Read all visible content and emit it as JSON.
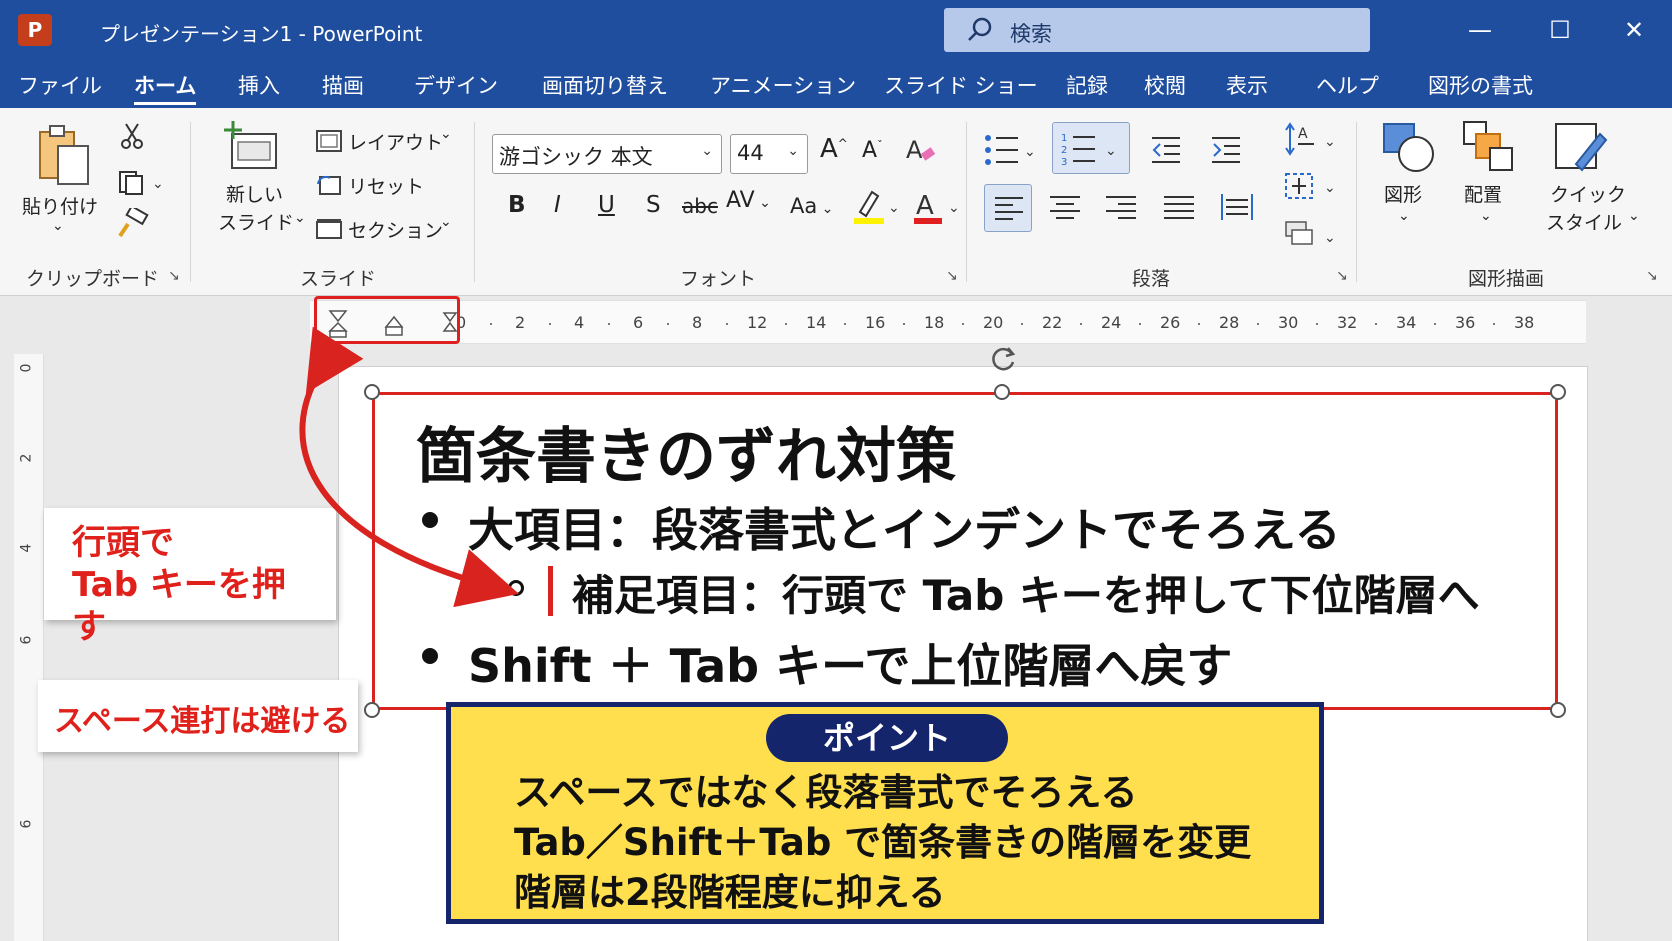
{
  "window": {
    "app_icon": "P",
    "title": "プレゼンテーション1  -  PowerPoint",
    "search_placeholder": "検索",
    "minimize": "—",
    "maximize": "☐",
    "close": "✕"
  },
  "menu_tabs": [
    "ファイル",
    "ホーム",
    "挿入",
    "描画",
    "デザイン",
    "画面切り替え",
    "アニメーション",
    "スライド ショー",
    "記録",
    "校閲",
    "表示",
    "ヘルプ",
    "図形の書式"
  ],
  "active_tab": "ホーム",
  "ribbon": {
    "clipboard": {
      "paste": "貼り付け",
      "label": "クリップボード"
    },
    "slides": {
      "new_slide_1": "新しい",
      "new_slide_2": "スライド",
      "layout": "レイアウト",
      "reset": "リセット",
      "section": "セクション",
      "label": "スライド"
    },
    "font": {
      "font_name": "游ゴシック 本文",
      "font_size": "44",
      "label": "フォント",
      "bold": "B",
      "italic": "I",
      "underline": "U",
      "shadow": "S",
      "strike": "abc",
      "spacing": "AV",
      "case": "Aa",
      "color": "A",
      "grow": "A",
      "shrink": "A"
    },
    "paragraph": {
      "label": "段落"
    },
    "drawing": {
      "shapes": "図形",
      "arrange": "配置",
      "quick_style_1": "クイック",
      "quick_style_2": "スタイル",
      "label": "図形描画"
    }
  },
  "ruler": {
    "numbers": [
      "0",
      "2",
      "4",
      "6",
      "8",
      "12",
      "14",
      "16",
      "18",
      "20",
      "22",
      "24",
      "26",
      "28",
      "30",
      "32",
      "34",
      "36",
      "38"
    ]
  },
  "vertical_ruler": {
    "numbers": [
      "0",
      "2",
      "4",
      "6",
      "6"
    ]
  },
  "slide": {
    "title": "箇条書きのずれ対策",
    "bullet_1": "大項目：段落書式とインデントでそろえる",
    "sub_bullet": "補足項目：行頭で Tab キーを押して下位階層へ",
    "bullet_2": "Shift ＋ Tab キーで上位階層へ戻す"
  },
  "callouts": {
    "tab_line1": "行頭で",
    "tab_line2": "Tab キーを押す",
    "space": "スペース連打は避ける"
  },
  "point": {
    "label": "ポイント",
    "lines": [
      "スペースではなく段落書式でそろえる",
      "Tab／Shift＋Tab で箇条書きの階層を変更",
      "階層は2段階程度に抑える"
    ]
  },
  "colors": {
    "titlebar": "#1f4e9e",
    "accent_red": "#d8231f",
    "point_bg": "#ffdf4e",
    "point_border": "#14256b"
  }
}
